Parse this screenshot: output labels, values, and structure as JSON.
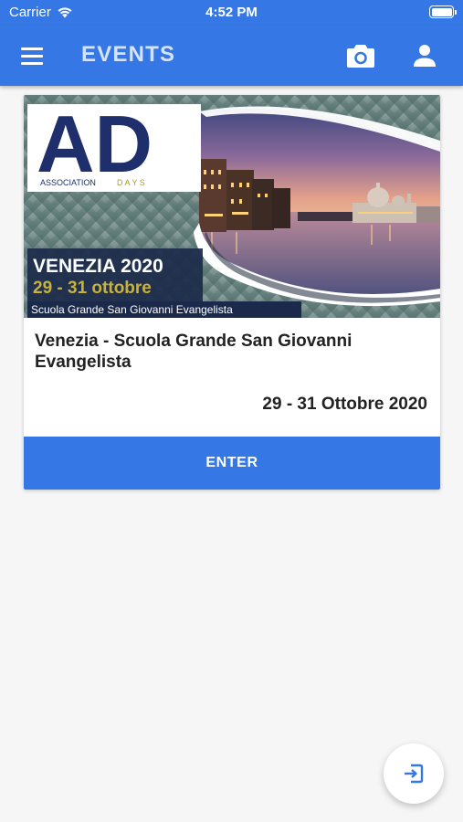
{
  "status_bar": {
    "carrier": "Carrier",
    "time": "4:52 PM",
    "wifi_icon": "wifi-icon",
    "battery_icon": "battery-icon"
  },
  "app_bar": {
    "title": "EVENTS",
    "menu_icon": "hamburger-menu-icon",
    "camera_icon": "camera-icon",
    "user_icon": "user-icon",
    "color": "#3578e5"
  },
  "event": {
    "banner": {
      "logo_letters": "AD",
      "logo_word_1": "ASSOCIATION",
      "logo_word_2": "D A Y S",
      "headline": "VENEZIA 2020",
      "dates": "29 - 31 ottobre",
      "venue": "Scuola Grande San Giovanni Evangelista"
    },
    "title": "Venezia - Scuola Grande San Giovanni Evangelista",
    "date": "29 - 31 Ottobre 2020",
    "enter_label": "ENTER"
  },
  "fab": {
    "icon": "login-icon"
  }
}
